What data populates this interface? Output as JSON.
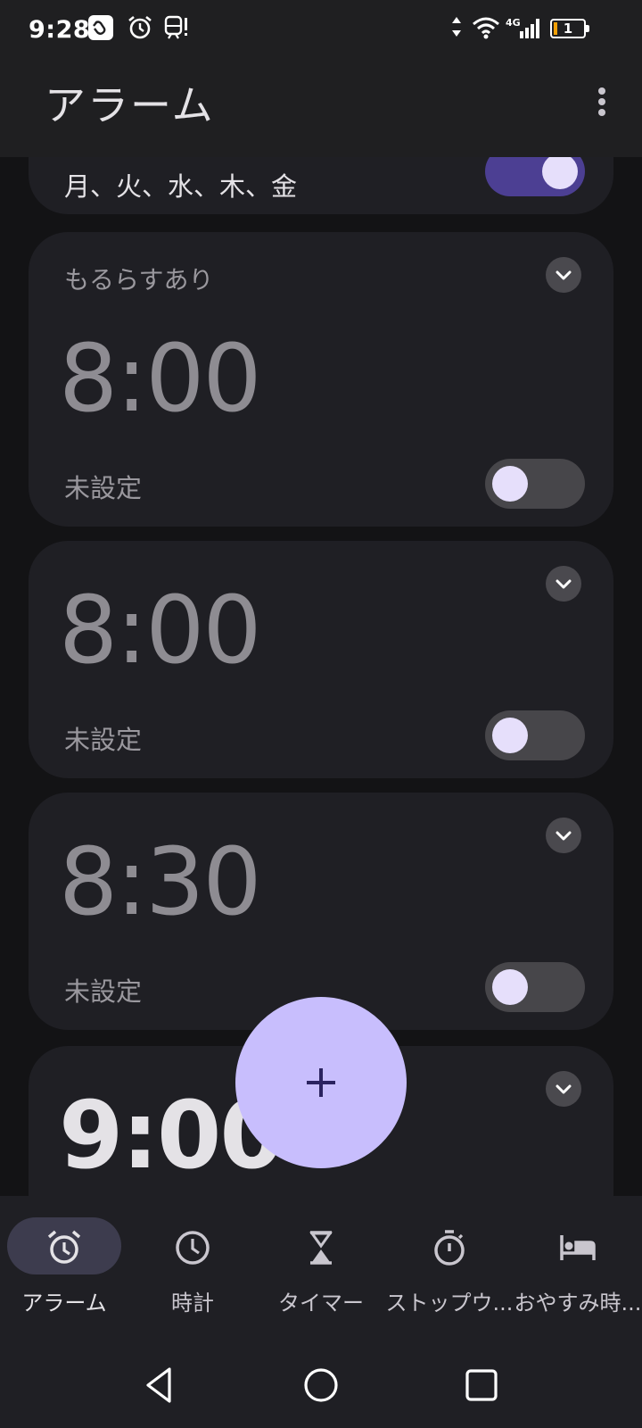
{
  "status_bar": {
    "time": "9:28",
    "battery_level": "1",
    "network": "4G",
    "icons": [
      "hand-notification-icon",
      "alarm-icon",
      "train-alert-icon",
      "data-arrows-icon",
      "wifi-icon",
      "cellular-signal-icon",
      "battery-icon"
    ]
  },
  "app_bar": {
    "title": "アラーム",
    "menu_icon": "more-vert-icon"
  },
  "alarms": [
    {
      "days": "月、火、水、木、金",
      "enabled": true
    },
    {
      "label": "もるらすあり",
      "time": "8:00",
      "status": "未設定",
      "enabled": false
    },
    {
      "time": "8:00",
      "status": "未設定",
      "enabled": false
    },
    {
      "time": "8:30",
      "status": "未設定",
      "enabled": false
    },
    {
      "time": "9:00",
      "enabled": true
    }
  ],
  "fab": {
    "icon": "add-icon"
  },
  "bottom_nav": {
    "active": "alarm",
    "items": [
      {
        "label": "アラーム",
        "icon": "alarm-icon"
      },
      {
        "label": "時計",
        "icon": "clock-icon"
      },
      {
        "label": "タイマー",
        "icon": "hourglass-icon"
      },
      {
        "label": "ストップウ...",
        "icon": "stopwatch-icon"
      },
      {
        "label": "おやすみ時...",
        "icon": "bed-icon"
      }
    ]
  },
  "colors": {
    "background": "#131315",
    "card": "#1f1f24",
    "accent": "#c8befd",
    "toggle_on": "#4c3f93",
    "toggle_off": "#47464a",
    "battery_low": "#f2a007"
  }
}
